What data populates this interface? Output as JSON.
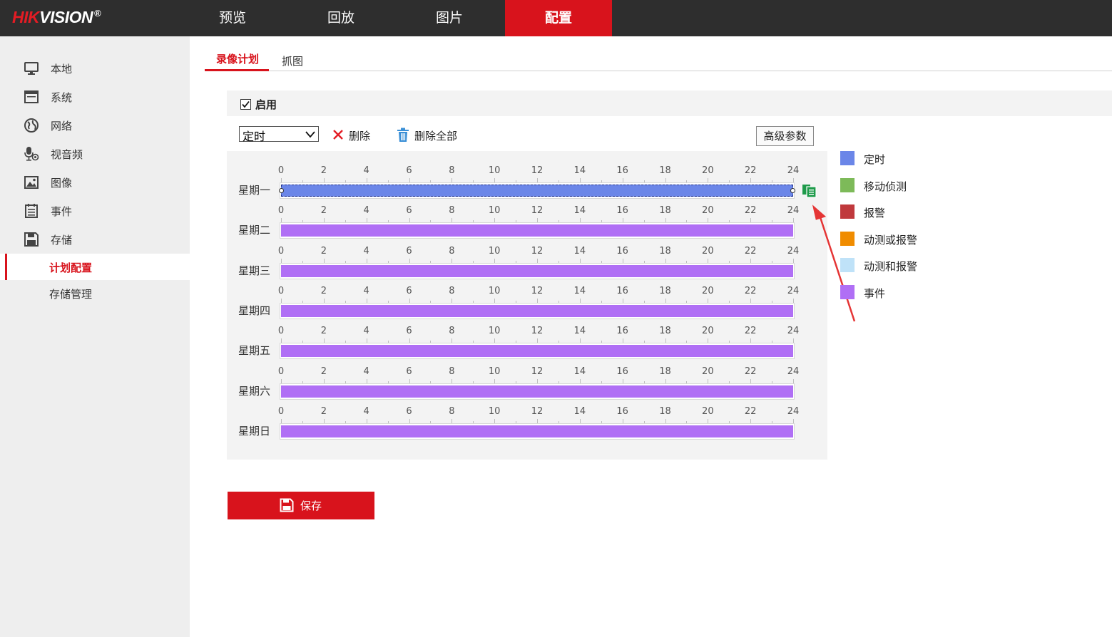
{
  "brand": {
    "logo_red": "HIK",
    "logo_white": "VISION",
    "logo_reg": "®"
  },
  "colors": {
    "topbar": "#2e2e2e",
    "accent": "#d8131c",
    "timer": "#6b86e8",
    "motion": "#7dba59",
    "alarm": "#c0393c",
    "motion_or_alarm": "#f08c00",
    "motion_and_alarm": "#bfe2f8",
    "event": "#b06ff5"
  },
  "nav": {
    "items": [
      {
        "label": "预览",
        "active": false
      },
      {
        "label": "回放",
        "active": false
      },
      {
        "label": "图片",
        "active": false
      },
      {
        "label": "配置",
        "active": true
      }
    ]
  },
  "sidebar": {
    "items": [
      {
        "label": "本地",
        "icon": "monitor-icon"
      },
      {
        "label": "系统",
        "icon": "window-icon"
      },
      {
        "label": "网络",
        "icon": "globe-icon"
      },
      {
        "label": "视音频",
        "icon": "microphone-camera-icon"
      },
      {
        "label": "图像",
        "icon": "image-icon"
      },
      {
        "label": "事件",
        "icon": "list-icon"
      },
      {
        "label": "存储",
        "icon": "floppy-icon"
      }
    ],
    "sub_items": [
      {
        "label": "计划配置",
        "active": true
      },
      {
        "label": "存储管理",
        "active": false
      }
    ]
  },
  "tabs": [
    {
      "label": "录像计划",
      "active": true
    },
    {
      "label": "抓图",
      "active": false
    }
  ],
  "enable": {
    "label": "启用",
    "checked": true
  },
  "toolbar": {
    "type_select": {
      "value": "定时"
    },
    "delete_label": "删除",
    "delete_all_label": "删除全部",
    "advanced_label": "高级参数"
  },
  "schedule": {
    "tick_labels": [
      "0",
      "2",
      "4",
      "6",
      "8",
      "10",
      "12",
      "14",
      "16",
      "18",
      "20",
      "22",
      "24"
    ],
    "days": [
      {
        "label": "星期一",
        "type": "timer",
        "start": 0,
        "end": 24,
        "selected": true
      },
      {
        "label": "星期二",
        "type": "event",
        "start": 0,
        "end": 24,
        "selected": false
      },
      {
        "label": "星期三",
        "type": "event",
        "start": 0,
        "end": 24,
        "selected": false
      },
      {
        "label": "星期四",
        "type": "event",
        "start": 0,
        "end": 24,
        "selected": false
      },
      {
        "label": "星期五",
        "type": "event",
        "start": 0,
        "end": 24,
        "selected": false
      },
      {
        "label": "星期六",
        "type": "event",
        "start": 0,
        "end": 24,
        "selected": false
      },
      {
        "label": "星期日",
        "type": "event",
        "start": 0,
        "end": 24,
        "selected": false
      }
    ]
  },
  "legend": [
    {
      "label": "定时",
      "color": "#6b86e8"
    },
    {
      "label": "移动侦测",
      "color": "#7dba59"
    },
    {
      "label": "报警",
      "color": "#c0393c"
    },
    {
      "label": "动测或报警",
      "color": "#f08c00"
    },
    {
      "label": "动测和报警",
      "color": "#bfe2f8"
    },
    {
      "label": "事件",
      "color": "#b06ff5"
    }
  ],
  "save_label": "保存"
}
